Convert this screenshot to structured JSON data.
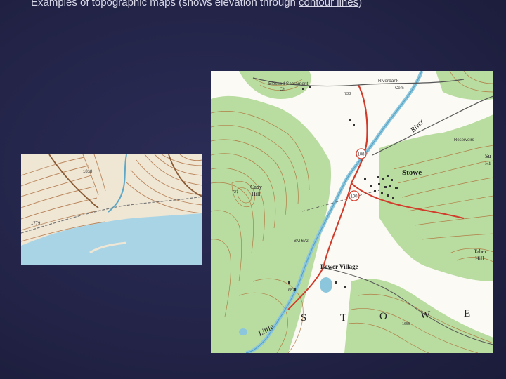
{
  "slide": {
    "title_prefix": "Examples of topographic maps (shows elevation through ",
    "title_link": "contour lines",
    "title_suffix": ")"
  },
  "colors": {
    "background": "#232448",
    "forest_green": "#b9dca0",
    "water_blue": "#a8d4e6",
    "contour_brown": "#b0733c",
    "road_red": "#d23a2a"
  },
  "small_map": {
    "labels": {
      "top_spot": "1818",
      "left_spot": "1779"
    }
  },
  "large_map": {
    "labels": {
      "church": "Blessed Sacrament",
      "church_ch": "Ch",
      "spot_733": "733",
      "riverbank": "Riverbank",
      "cem": "Cem",
      "reservoirs": "Reservoirs",
      "sugar_hill_top": "Su",
      "sugar_hill_bottom": "Hi",
      "route_108": "108",
      "route_100": "100",
      "stowe": "Stowe",
      "cady": "Cady",
      "cady_hill": "Hill",
      "spot_727": "727",
      "bm_672": "BM 672",
      "taber": "Taber",
      "taber_hill": "Hill",
      "lower_village": "Lower Village",
      "spot_687": "687",
      "spot_1655": "1655",
      "river_little": "Little",
      "big_letters": [
        "S",
        "T",
        "O",
        "W",
        "E"
      ],
      "river_top": "River"
    }
  }
}
